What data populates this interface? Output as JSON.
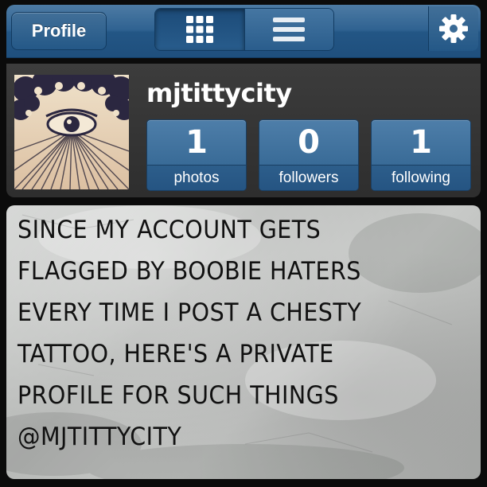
{
  "navbar": {
    "back_label": "Profile",
    "view_toggle": [
      {
        "icon": "grid-view-icon",
        "active": true
      },
      {
        "icon": "list-view-icon",
        "active": false
      }
    ],
    "settings_icon": "gear-icon"
  },
  "profile": {
    "username": "mjtittycity",
    "avatar_icon": "all-seeing-eye-avatar",
    "stats": [
      {
        "count": "1",
        "label": "photos"
      },
      {
        "count": "0",
        "label": "followers"
      },
      {
        "count": "1",
        "label": "following"
      }
    ]
  },
  "post": {
    "lines": [
      "SINCE MY ACCOUNT GETS",
      "FLAGGED BY BOOBIE HATERS",
      "EVERY TIME I POST A CHESTY",
      "TATTOO, HERE'S A PRIVATE",
      "PROFILE FOR SUCH THINGS",
      "@MJTITTYCITY"
    ]
  },
  "colors": {
    "nav_blue": "#2f6291",
    "button_blue": "#3a6c98",
    "card_dark": "#333333",
    "post_gray": "#c0c2c0"
  }
}
